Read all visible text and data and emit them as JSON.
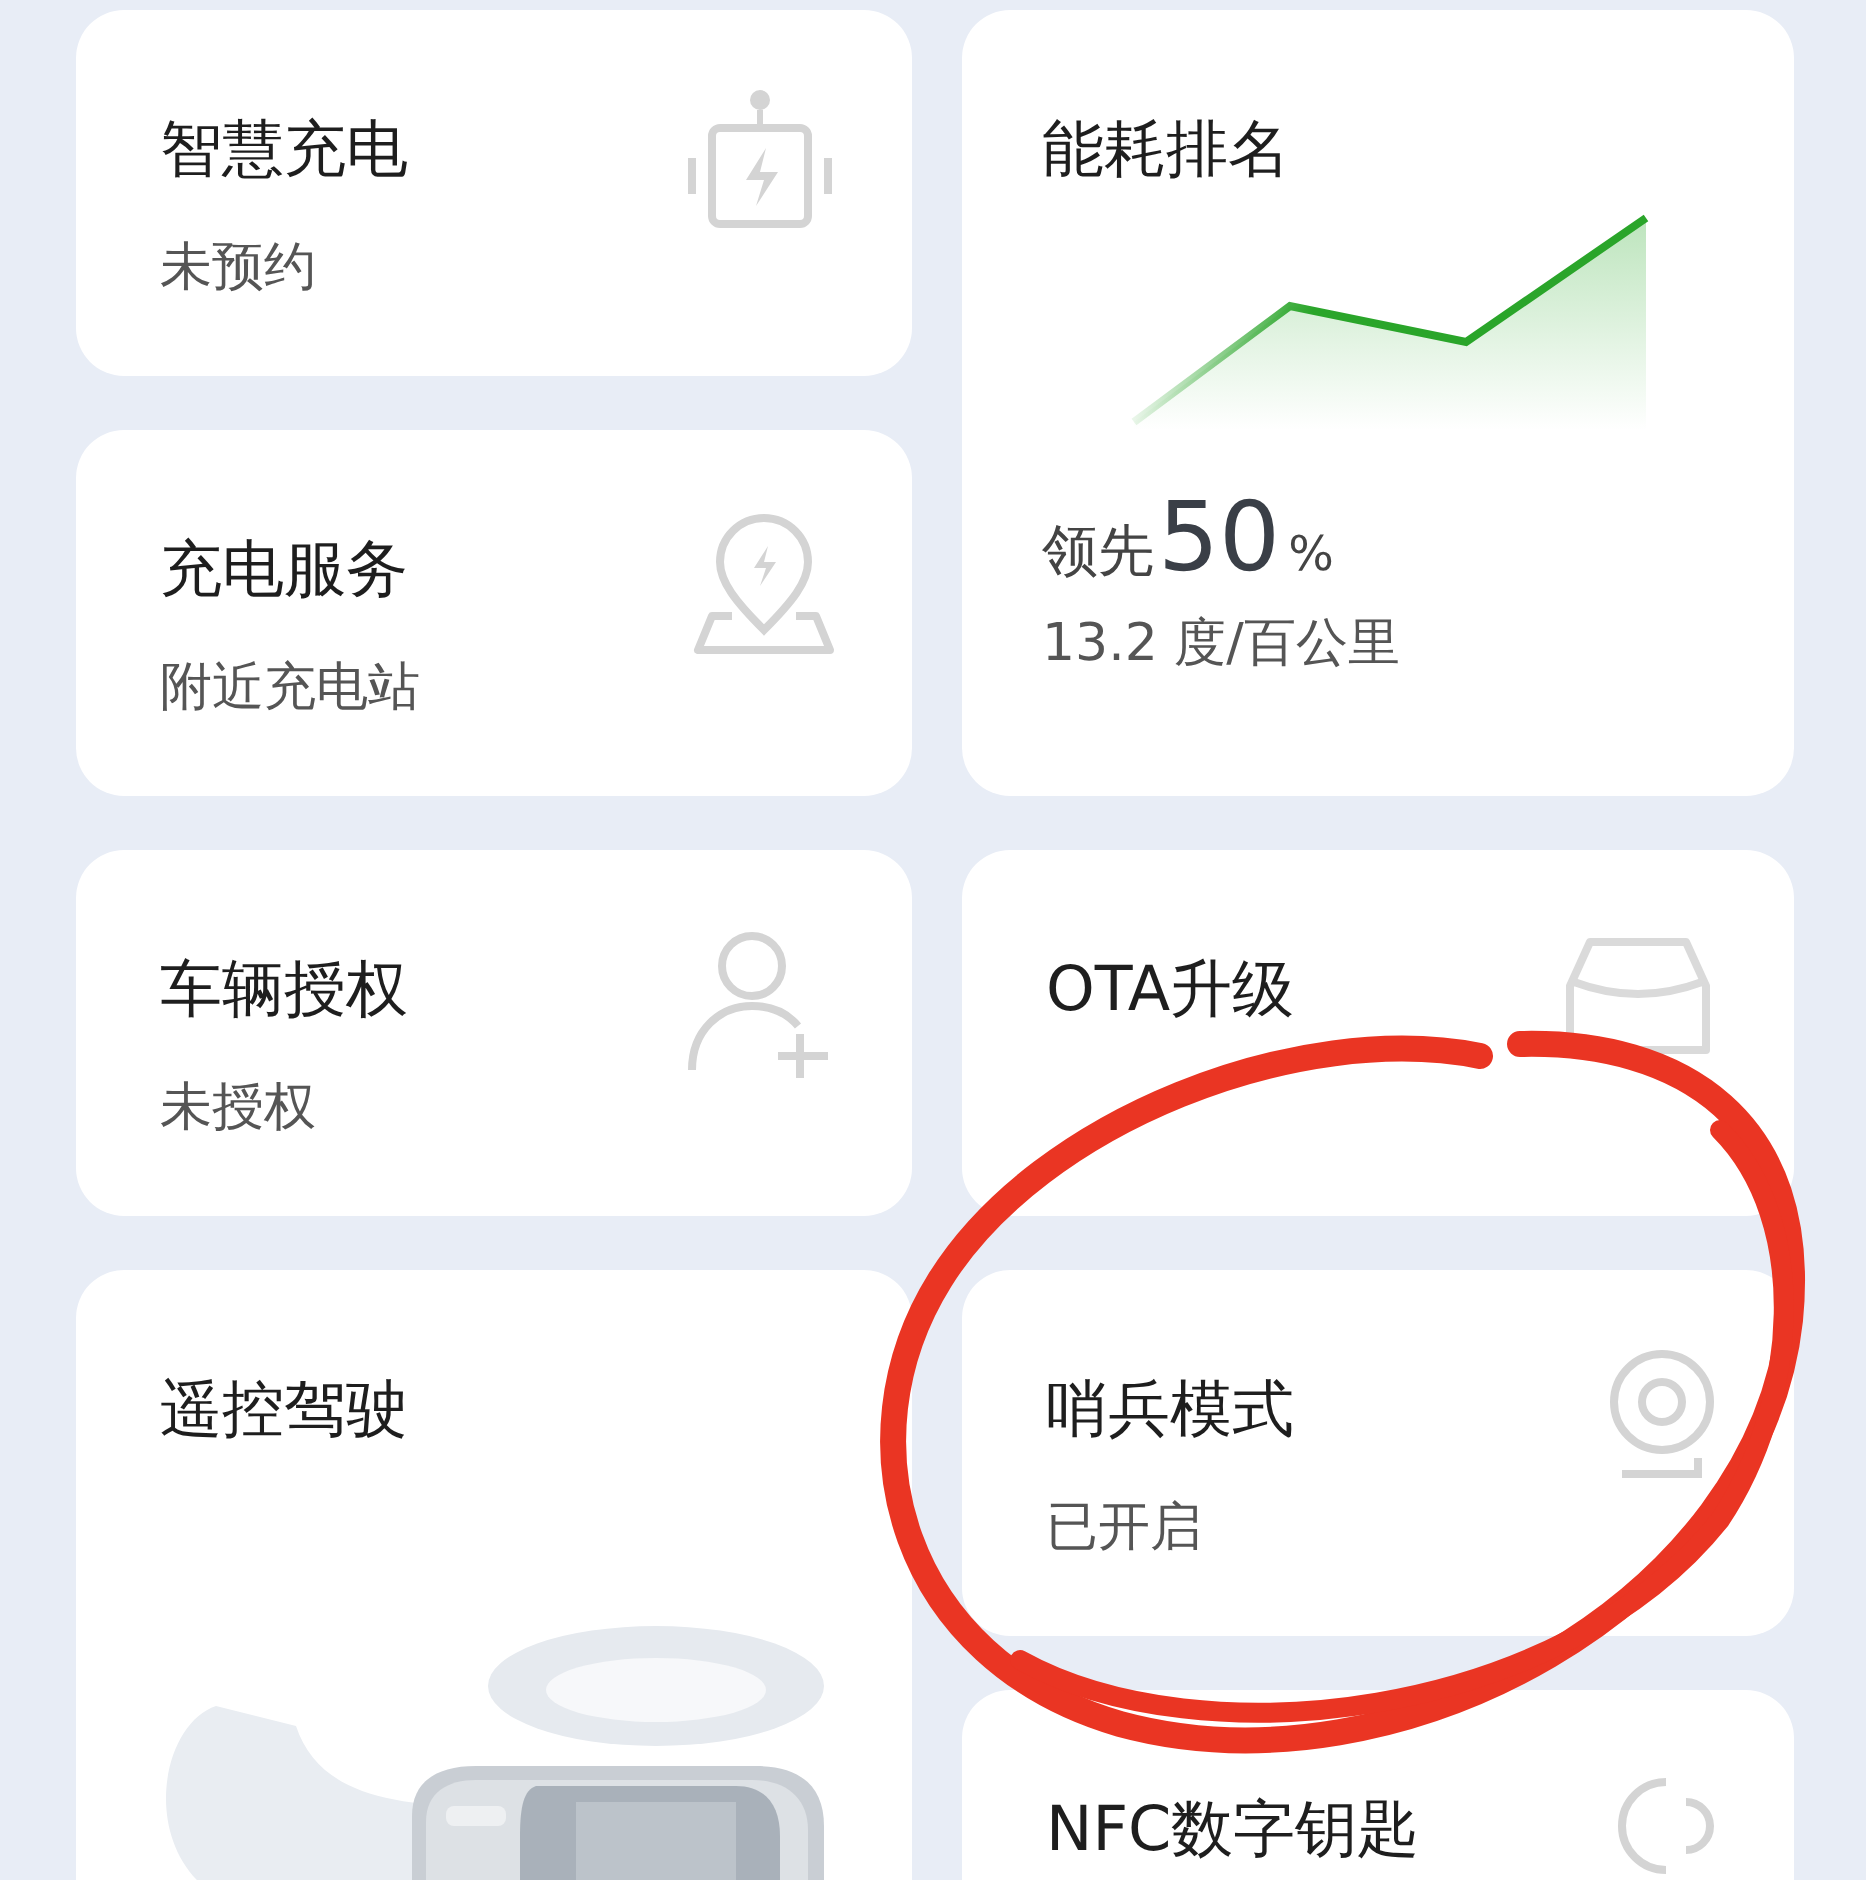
{
  "left_column": [
    {
      "kind": "charging",
      "title": "智慧充电",
      "subtitle": "未预约"
    },
    {
      "kind": "station",
      "title": "充电服务",
      "subtitle": "附近充电站"
    },
    {
      "kind": "authorization",
      "title": "车辆授权",
      "subtitle": "未授权"
    },
    {
      "kind": "remote",
      "title": "遥控驾驶"
    }
  ],
  "right_column": [
    {
      "kind": "ranking",
      "title": "能耗排名",
      "lead_label": "领先",
      "percent": "50",
      "percent_sign": "%",
      "consumption": "13.2 度/百公里"
    },
    {
      "kind": "ota",
      "title": "OTA升级"
    },
    {
      "kind": "sentry",
      "title": "哨兵模式",
      "subtitle": "已开启"
    },
    {
      "kind": "nfc",
      "title": "NFC数字钥匙"
    }
  ]
}
